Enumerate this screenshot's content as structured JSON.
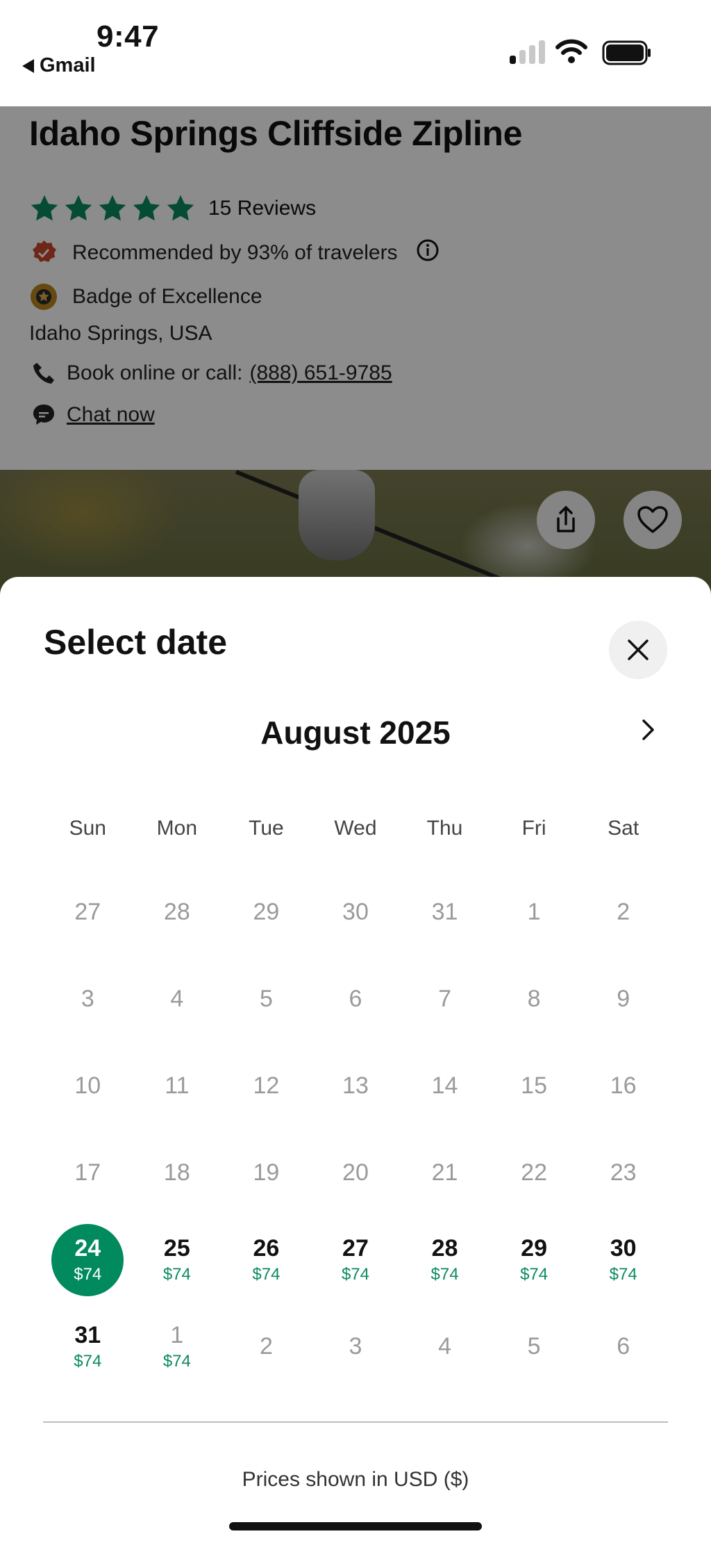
{
  "status_bar": {
    "time": "9:47",
    "back_app": "Gmail"
  },
  "listing": {
    "title": "Idaho Springs Cliffside Zipline",
    "rating": 5,
    "reviews": "15 Reviews",
    "recommended": "Recommended by 93% of travelers",
    "badge": "Badge of Excellence",
    "location": "Idaho Springs, USA",
    "book_prefix": "Book online or call:",
    "phone": "(888) 651-9785",
    "chat": "Chat now"
  },
  "date_sheet": {
    "title": "Select date",
    "month": "August 2025",
    "weekdays": [
      "Sun",
      "Mon",
      "Tue",
      "Wed",
      "Thu",
      "Fri",
      "Sat"
    ],
    "weeks": [
      [
        {
          "d": "27"
        },
        {
          "d": "28"
        },
        {
          "d": "29"
        },
        {
          "d": "30"
        },
        {
          "d": "31"
        },
        {
          "d": "1"
        },
        {
          "d": "2"
        }
      ],
      [
        {
          "d": "3"
        },
        {
          "d": "4"
        },
        {
          "d": "5"
        },
        {
          "d": "6"
        },
        {
          "d": "7"
        },
        {
          "d": "8"
        },
        {
          "d": "9"
        }
      ],
      [
        {
          "d": "10"
        },
        {
          "d": "11"
        },
        {
          "d": "12"
        },
        {
          "d": "13"
        },
        {
          "d": "14"
        },
        {
          "d": "15"
        },
        {
          "d": "16"
        }
      ],
      [
        {
          "d": "17"
        },
        {
          "d": "18"
        },
        {
          "d": "19"
        },
        {
          "d": "20"
        },
        {
          "d": "21"
        },
        {
          "d": "22"
        },
        {
          "d": "23"
        }
      ],
      [
        {
          "d": "24",
          "p": "$74",
          "sel": true
        },
        {
          "d": "25",
          "p": "$74"
        },
        {
          "d": "26",
          "p": "$74"
        },
        {
          "d": "27",
          "p": "$74"
        },
        {
          "d": "28",
          "p": "$74"
        },
        {
          "d": "29",
          "p": "$74"
        },
        {
          "d": "30",
          "p": "$74"
        }
      ],
      [
        {
          "d": "31",
          "p": "$74"
        },
        {
          "d": "1",
          "p": "$74",
          "faint": true
        },
        {
          "d": "2"
        },
        {
          "d": "3"
        },
        {
          "d": "4"
        },
        {
          "d": "5"
        },
        {
          "d": "6"
        }
      ]
    ],
    "footer": "Prices shown in USD ($)"
  },
  "colors": {
    "accent": "#008a5e",
    "price_text": "#0b8a5f",
    "recommend_badge": "#c6452b",
    "award_badge": "#b8861f"
  },
  "icons": [
    "back-triangle-icon",
    "signal-icon",
    "wifi-icon",
    "battery-icon",
    "star-icon",
    "recommend-badge-icon",
    "info-icon",
    "award-badge-icon",
    "phone-icon",
    "chat-icon",
    "share-icon",
    "heart-icon",
    "close-icon",
    "chevron-right-icon"
  ]
}
